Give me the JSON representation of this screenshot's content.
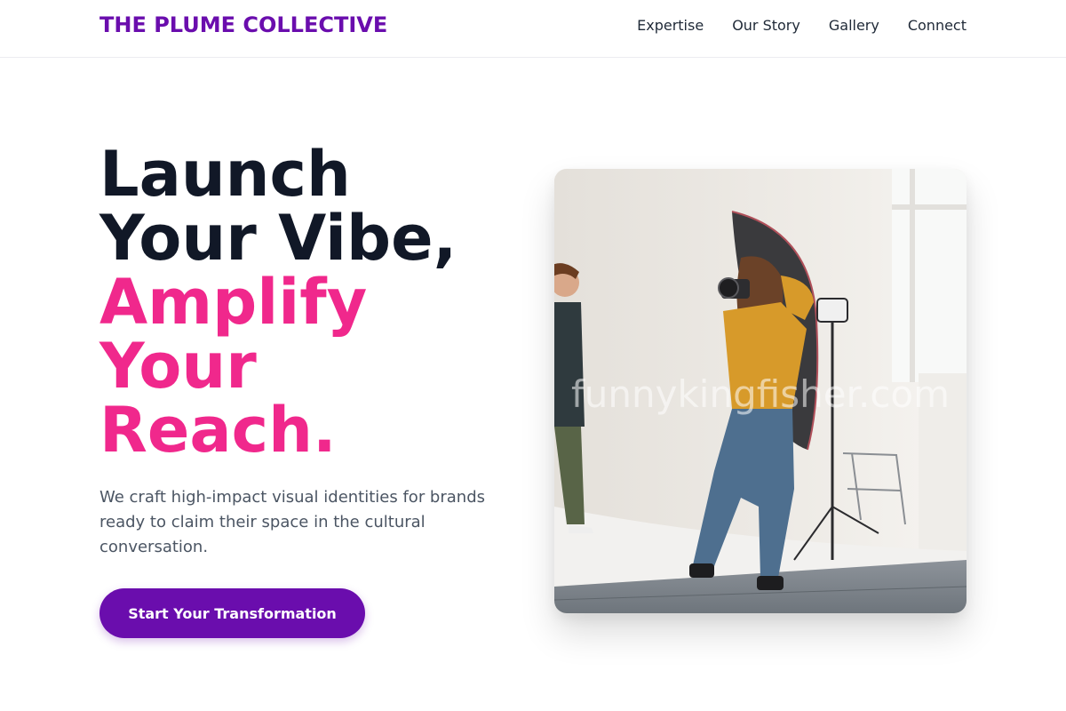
{
  "brand": {
    "name": "THE PLUME COLLECTIVE",
    "color": "#6a0dad"
  },
  "nav": {
    "items": [
      "Expertise",
      "Our Story",
      "Gallery",
      "Connect"
    ]
  },
  "hero": {
    "headline_line1": "Launch",
    "headline_line2": "Your Vibe,",
    "headline_line3": "Amplify",
    "headline_line4": "Your",
    "headline_line5": "Reach.",
    "accent_color": "#f0288c",
    "description": "We craft high-impact visual identities for brands ready to claim their space in the cultural conversation.",
    "cta_label": "Start Your Transformation"
  },
  "image": {
    "subject": "photographer-in-studio-photo",
    "watermark": "funnykingfisher.com"
  }
}
